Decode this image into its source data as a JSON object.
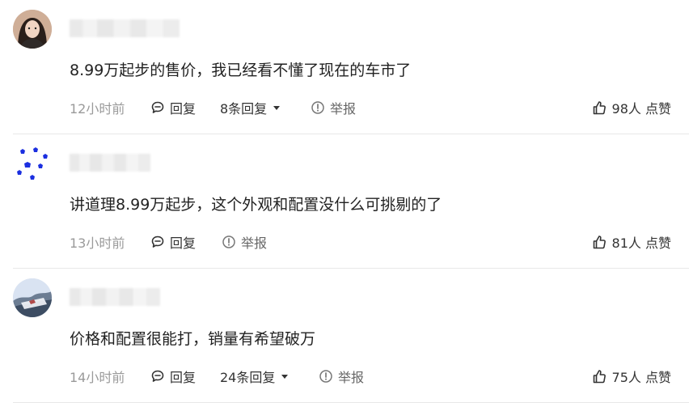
{
  "comments": [
    {
      "content": "8.99万起步的售价，我已经看不懂了现在的车市了",
      "time": "12小时前",
      "reply_label": "回复",
      "replies_label": "8条回复",
      "report_label": "举报",
      "likes_label": "98人 点赞"
    },
    {
      "content": "讲道理8.99万起步，这个外观和配置没什么可挑剔的了",
      "time": "13小时前",
      "reply_label": "回复",
      "report_label": "举报",
      "likes_label": "81人 点赞"
    },
    {
      "content": "价格和配置很能打，销量有希望破万",
      "time": "14小时前",
      "reply_label": "回复",
      "replies_label": "24条回复",
      "report_label": "举报",
      "likes_label": "75人 点赞"
    }
  ],
  "icons": {
    "reply": "comment-bubble-icon",
    "replies_toggle": "caret-down-icon",
    "report": "report-info-icon",
    "like": "thumbs-up-icon"
  }
}
